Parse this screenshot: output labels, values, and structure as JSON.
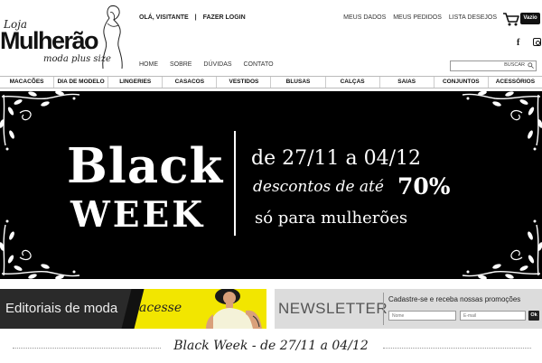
{
  "logo": {
    "prefix": "Loja",
    "name": "Mulherão",
    "tagline": "moda plus size"
  },
  "header": {
    "welcome": "OLÁ, VISITANTE",
    "separator": "|",
    "login": "FAZER LOGIN",
    "account_links": [
      "MEUS DADOS",
      "MEUS PEDIDOS",
      "LISTA DESEJOS"
    ],
    "cart_label": "Vazio",
    "facebook": "f",
    "subnav": [
      "HOME",
      "SOBRE",
      "DÚVIDAS",
      "CONTATO"
    ],
    "search_button": "BUSCAR"
  },
  "nav": {
    "items": [
      "MACACÕES",
      "DIA DE MODELO",
      "LINGERIES",
      "CASACOS",
      "VESTIDOS",
      "BLUSAS",
      "CALÇAS",
      "SAIAS",
      "CONJUNTOS",
      "ACESSÓRIOS"
    ]
  },
  "banner": {
    "line1": "Black",
    "line2": "WEEK",
    "dates": "de 27/11 a 04/12",
    "discount_text": "descontos de até",
    "discount_value": "70%",
    "audience": "só para mulherões"
  },
  "editorial": {
    "title": "Editoriais de moda",
    "cta": "acesse",
    "accent": "#f2e600"
  },
  "newsletter": {
    "title": "NEWSLETTER",
    "prompt": "Cadastre-se e receba nossas promoções",
    "name_placeholder": "Nome",
    "email_placeholder": "E-mail",
    "submit": "Ok"
  },
  "section": {
    "title": "Black Week - de 27/11 a 04/12"
  }
}
